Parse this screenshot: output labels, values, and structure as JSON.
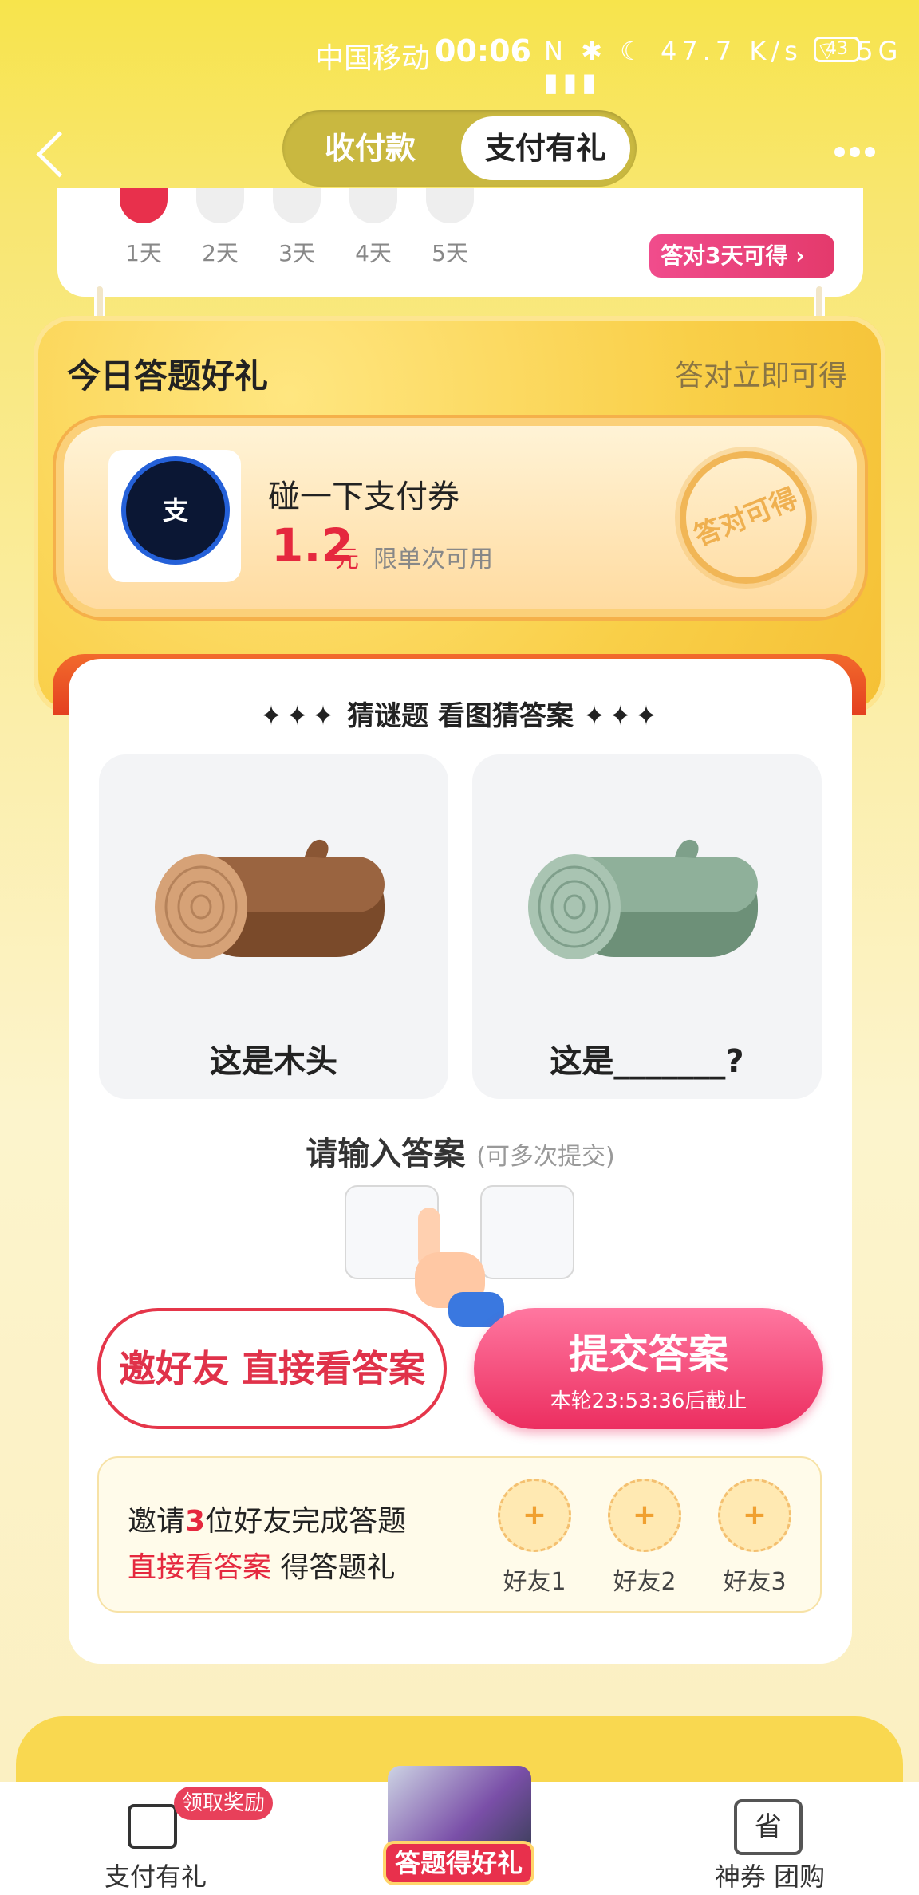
{
  "status_bar": {
    "carrier": "中国移动",
    "time": "00:06",
    "icons": "N ✱ ☾ 47.7 K/s ⌔ 5G ▮▮▮",
    "battery": "43"
  },
  "header": {
    "segment_left": "收付款",
    "segment_right": "支付有礼"
  },
  "streak": {
    "days": [
      "1天",
      "2天",
      "3天",
      "4天",
      "5天"
    ],
    "badge": "答对3天可得 ›"
  },
  "gift_board": {
    "title": "今日答题好礼",
    "right_label": "答对立即可得",
    "coupon": {
      "logo_text": "支",
      "name": "碰一下支付券",
      "amount": "1.2",
      "unit": "元",
      "limit": "限单次可用",
      "stamp": "答对可得"
    }
  },
  "quiz": {
    "subtitle_stars": "✦✦✦",
    "subtitle": "猜谜题 看图猜答案",
    "images": [
      {
        "caption": "这是木头",
        "icon": "wooden-log"
      },
      {
        "caption": "这是_______?",
        "icon": "jade-log"
      }
    ],
    "prompt": "请输入答案",
    "prompt_note": "(可多次提交)",
    "invite_button": "邀好友 直接看答案",
    "submit_button": "提交答案",
    "submit_sub": "本轮23:53:36后截止",
    "invite_panel": {
      "line1_pre": "邀请",
      "line1_num": "3",
      "line1_post": "位好友完成答题",
      "line2_highlight": "直接看答案",
      "line2_rest": " 得答题礼",
      "friends": [
        "好友1",
        "好友2",
        "好友3"
      ],
      "plus": "+"
    }
  },
  "tab_bar": {
    "tab1_label": "支付有礼",
    "tab1_badge": "领取奖励",
    "tab2_label": "答题得好礼",
    "tab3_icon_text": "省",
    "tab3_label": "神券 团购"
  },
  "colors": {
    "accent_red": "#e5283e",
    "brand_yellow": "#f7e44c",
    "submit_pink": "#ec2e60"
  }
}
